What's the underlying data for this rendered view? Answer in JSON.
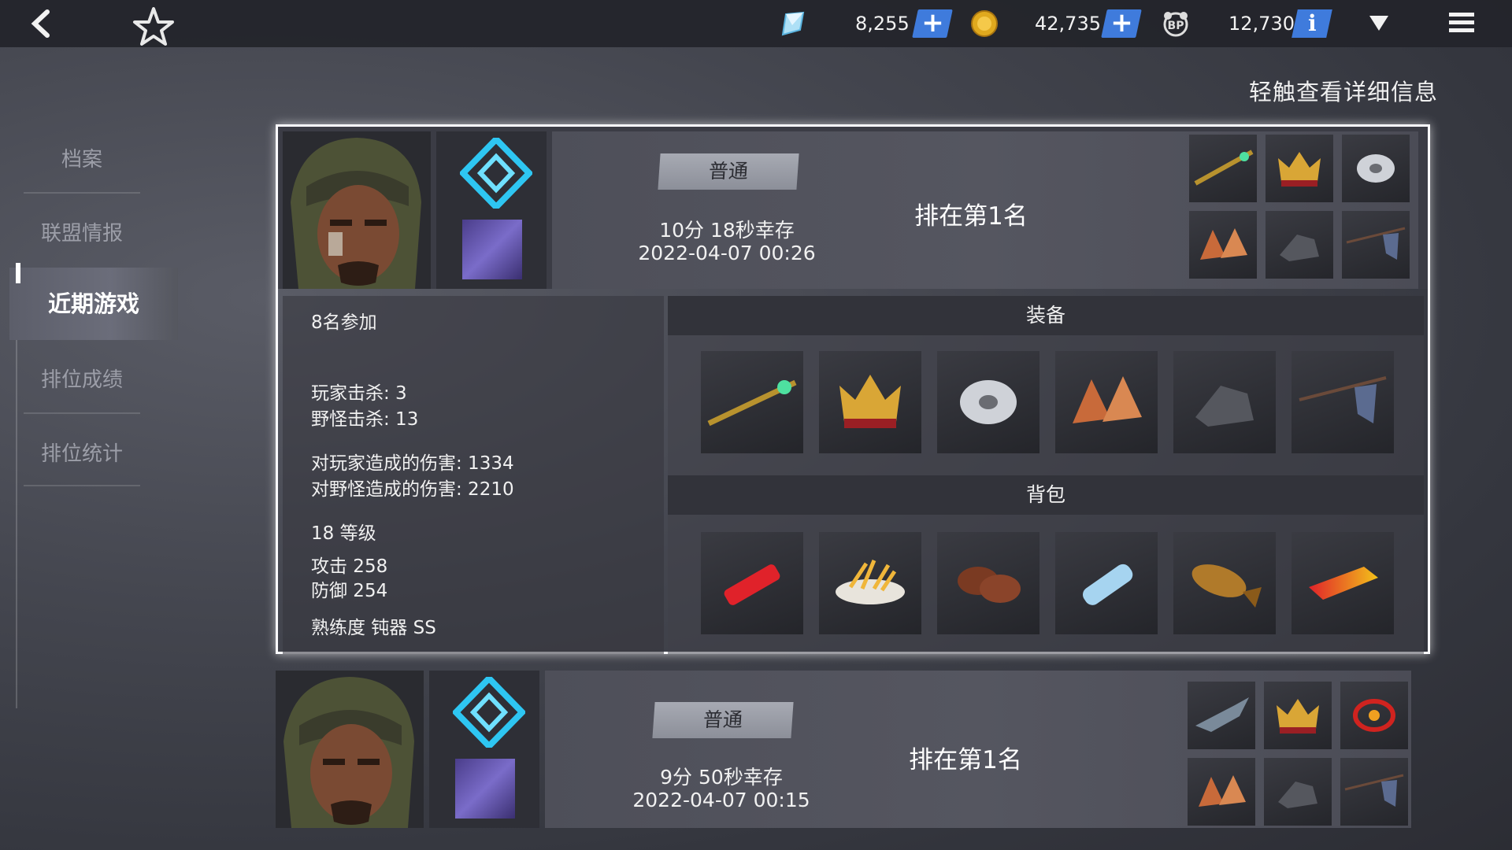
{
  "topbar": {
    "back_icon": "back-arrow-icon",
    "favorite_icon": "star-icon",
    "currencies": [
      {
        "icon": "crystal-icon",
        "value": "8,255",
        "action": "plus"
      },
      {
        "icon": "gold-coin-icon",
        "value": "42,735",
        "action": "plus"
      },
      {
        "icon": "bp-icon",
        "value": "12,730",
        "action": "info"
      }
    ],
    "plus_label": "+",
    "info_label": "i",
    "dropdown_icon": "triangle-down-icon",
    "menu_icon": "hamburger-menu-icon"
  },
  "hint": "轻触查看详细信息",
  "sidebar": {
    "items": [
      "档案",
      "联盟情报",
      "近期游戏",
      "排位成绩",
      "排位统计"
    ],
    "active_index": 2
  },
  "matches": [
    {
      "mode": "普通",
      "survival": "10分 18秒幸存",
      "date": "2022-04-07 00:26",
      "rank": "排在第1名",
      "mini_items": [
        "staff-icon",
        "crown-icon",
        "disc-icon",
        "gauntlet-icon",
        "boots-icon",
        "flag-icon"
      ],
      "expanded": true,
      "details": {
        "participants": "8名参加",
        "player_kills": "玩家击杀: 3",
        "monster_kills": "野怪击杀: 13",
        "player_damage": "对玩家造成的伤害: 1334",
        "monster_damage": "对野怪造成的伤害: 2210",
        "level": "18 等级",
        "attack": "攻击 258",
        "defense": "防御 254",
        "mastery": "熟练度  钝器 SS"
      },
      "equipment_title": "装备",
      "equipment": [
        "staff-icon",
        "crown-icon",
        "disc-icon",
        "gauntlet-icon",
        "boots-icon",
        "flag-icon"
      ],
      "inventory_title": "背包",
      "inventory": [
        "lighter-icon",
        "fries-icon",
        "cookies-icon",
        "water-bottle-icon",
        "grilled-fish-icon",
        "red-gold-block-icon"
      ]
    },
    {
      "mode": "普通",
      "survival": "9分 50秒幸存",
      "date": "2022-04-07 00:15",
      "rank": "排在第1名",
      "mini_items": [
        "drone-icon",
        "crown-icon",
        "red-gem-icon",
        "gauntlet-icon",
        "boots-icon",
        "flag-icon"
      ],
      "expanded": false
    }
  ]
}
